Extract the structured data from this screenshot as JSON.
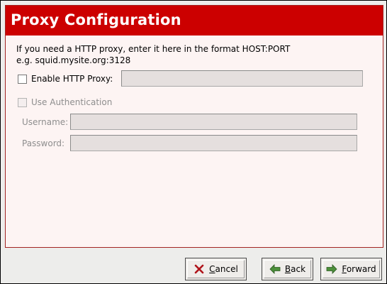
{
  "header": {
    "title": "Proxy Configuration"
  },
  "instructions": {
    "line1": "If you need a HTTP proxy, enter it here in the format HOST:PORT",
    "line2": "e.g. squid.mysite.org:3128"
  },
  "proxy": {
    "enable_label": "Enable HTTP Proxy:",
    "enabled": false,
    "value": ""
  },
  "auth": {
    "use_label": "Use Authentication",
    "enabled": false,
    "username_label": "Username:",
    "username_value": "",
    "password_label": "Password:",
    "password_value": ""
  },
  "buttons": {
    "cancel_prefix": "",
    "cancel_mnemonic": "C",
    "cancel_rest": "ancel",
    "back_mnemonic": "B",
    "back_rest": "ack",
    "forward_mnemonic": "F",
    "forward_rest": "orward"
  },
  "icons": {
    "cancel": "x-mark-icon",
    "back": "arrow-left-icon",
    "forward": "arrow-right-icon"
  },
  "colors": {
    "header": "#cc0000",
    "card_bg": "#fdf4f3",
    "window_bg": "#ededeb"
  }
}
